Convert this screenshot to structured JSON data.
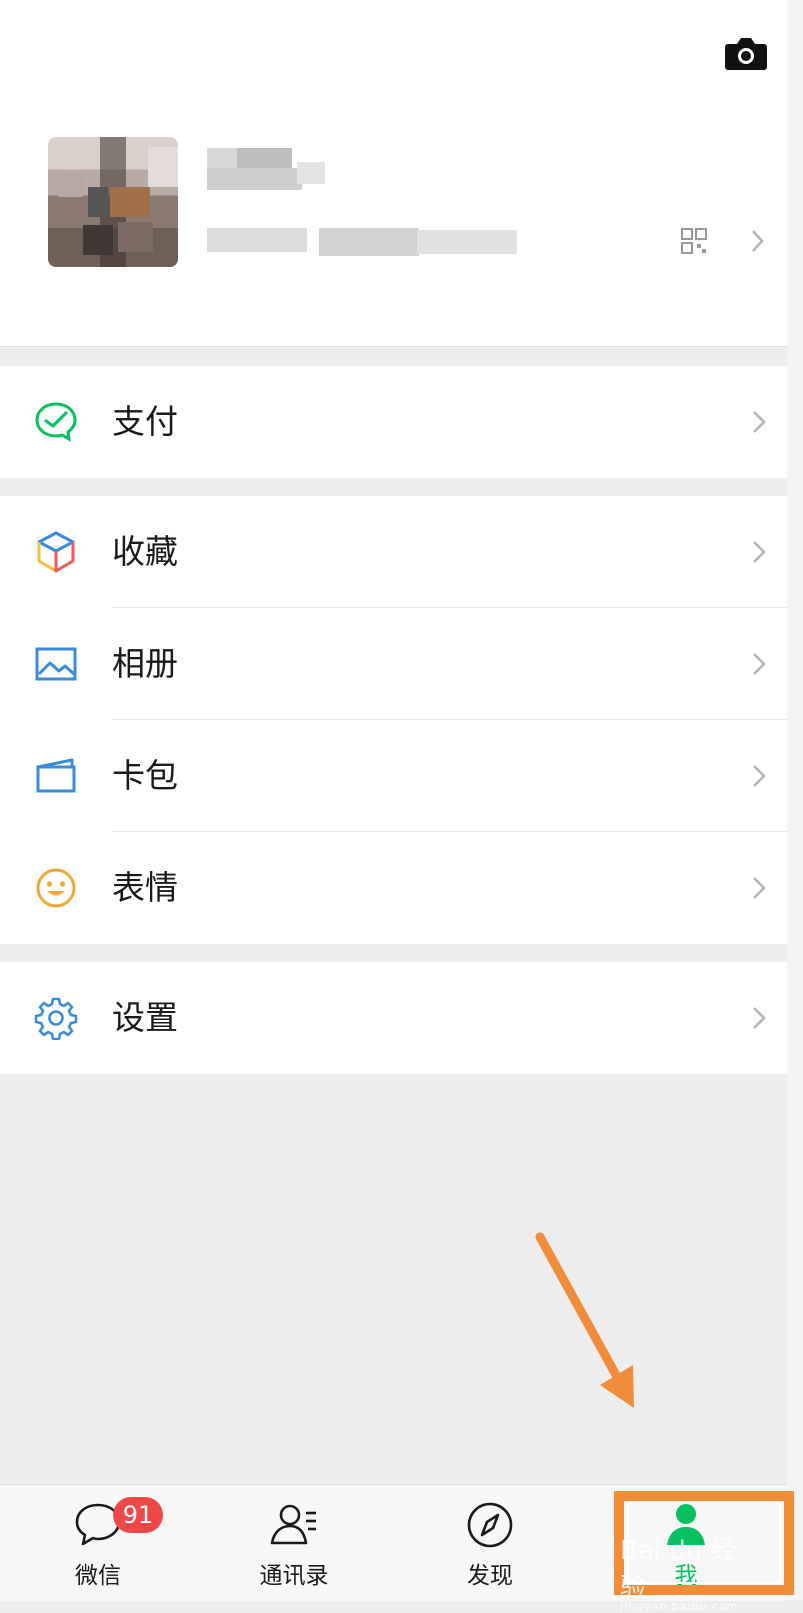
{
  "menu": {
    "group1": [
      {
        "label": "支付",
        "icon": "wechat-pay-icon"
      }
    ],
    "group2": [
      {
        "label": "收藏",
        "icon": "favorites-cube-icon"
      },
      {
        "label": "相册",
        "icon": "album-image-icon"
      },
      {
        "label": "卡包",
        "icon": "card-wallet-icon"
      },
      {
        "label": "表情",
        "icon": "smiley-icon"
      }
    ],
    "group3": [
      {
        "label": "设置",
        "icon": "gear-icon"
      }
    ]
  },
  "tabbar": {
    "tabs": [
      {
        "label": "微信",
        "icon": "chat-bubble-icon",
        "badge": "91"
      },
      {
        "label": "通讯录",
        "icon": "contacts-icon"
      },
      {
        "label": "发现",
        "icon": "compass-icon"
      },
      {
        "label": "我",
        "icon": "person-icon",
        "active": true
      }
    ]
  },
  "watermark": {
    "main": "Bai du 经验",
    "sub": "jingyan.baidu.com"
  },
  "colors": {
    "brand_green": "#07c160",
    "badge_red": "#f04848",
    "annotation_orange": "#f08c3a",
    "page_bg": "#ededed"
  }
}
